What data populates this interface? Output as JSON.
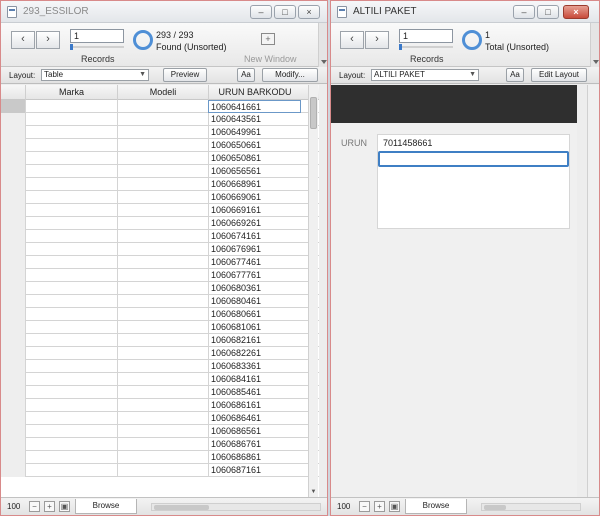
{
  "window1": {
    "title": "293_ESSILOR",
    "record_input": "1",
    "records_label": "Records",
    "found_count": "293 / 293",
    "found_label": "Found (Unsorted)",
    "new_window_label": "New Window",
    "layout_label": "Layout:",
    "layout_value": "Table",
    "preview_label": "Preview",
    "aa_label": "Aa",
    "modify_label": "Modify...",
    "columns": [
      "Marka",
      "Modeli",
      "URUN BARKODU"
    ],
    "barcodes": [
      "1060641661",
      "1060643561",
      "1060649961",
      "1060650661",
      "1060650861",
      "1060656561",
      "1060668961",
      "1060669061",
      "1060669161",
      "1060669261",
      "1060674161",
      "1060676961",
      "1060677461",
      "1060677761",
      "1060680361",
      "1060680461",
      "1060680661",
      "1060681061",
      "1060682161",
      "1060682261",
      "1060683361",
      "1060684161",
      "1060685461",
      "1060686161",
      "1060686461",
      "1060686561",
      "1060686761",
      "1060686861",
      "1060687161"
    ],
    "zoom": "100",
    "mode": "Browse"
  },
  "window2": {
    "title": "ALTILI PAKET",
    "record_input": "1",
    "records_label": "Records",
    "found_count": "1",
    "found_label": "Total (Unsorted)",
    "layout_label": "Layout:",
    "layout_value": "ALTILI PAKET",
    "aa_label": "Aa",
    "edit_layout_label": "Edit Layout",
    "field_label": "URUN",
    "field_value": "7011458661",
    "zoom": "100",
    "mode": "Browse"
  },
  "icons": {
    "back": "chevron-left-icon",
    "forward": "chevron-right-icon",
    "pie": "record-pie-icon",
    "new_window": "new-window-icon"
  },
  "colors": {
    "accent": "#4f8fd6",
    "close_button": "#c84a3a",
    "dark_header": "#2f2f2f"
  }
}
